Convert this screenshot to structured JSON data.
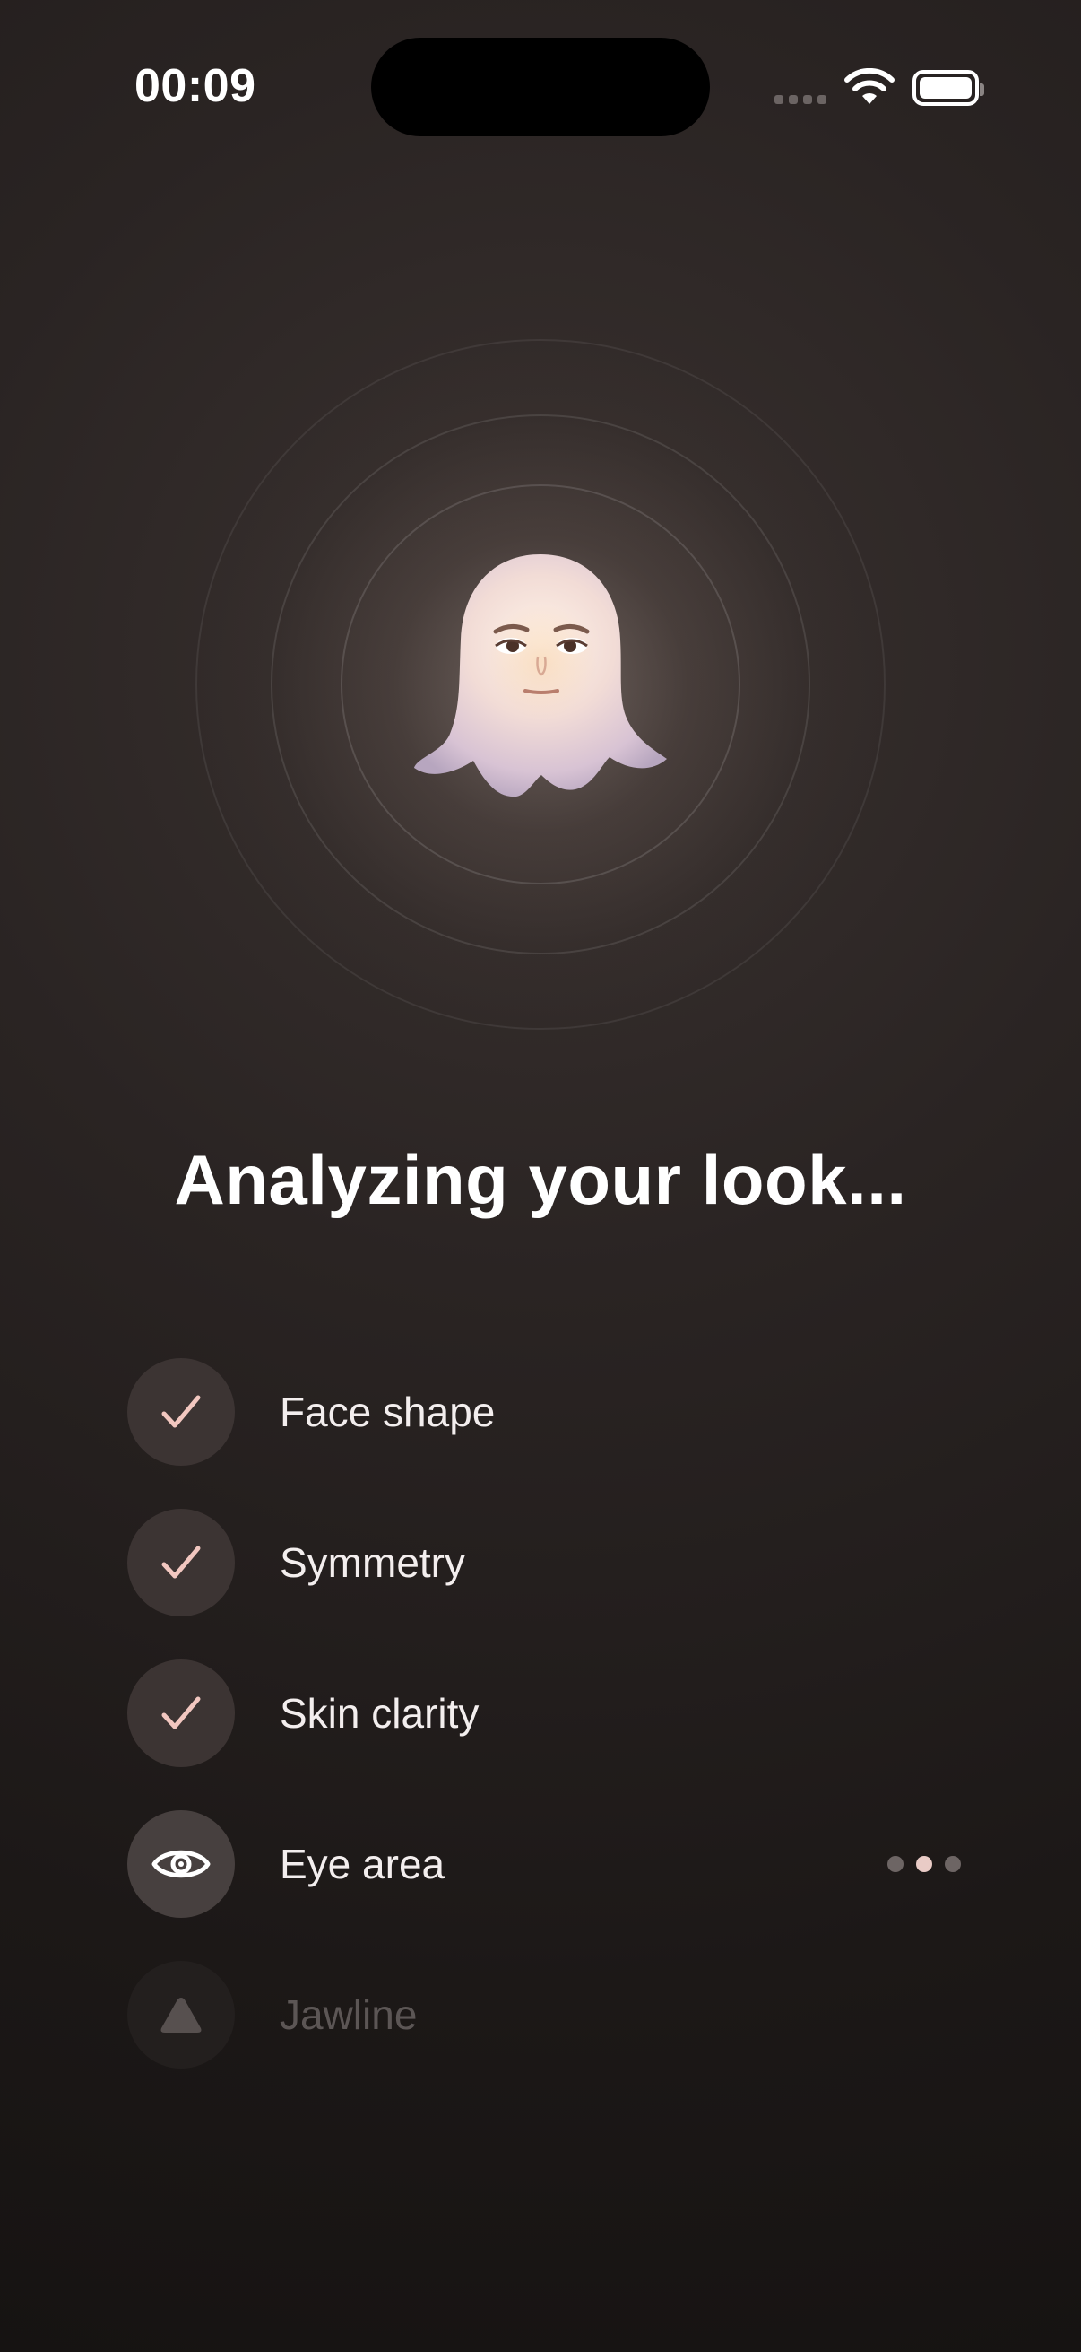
{
  "status_bar": {
    "time": "00:09"
  },
  "title": "Analyzing your look...",
  "colors": {
    "background": "#1c1817",
    "check_accent": "#f2c7c0",
    "done_circle": "#3c3433",
    "active_circle": "#47403f",
    "pending_circle": "#231f1e",
    "pending_text": "#5c5655"
  },
  "checks": [
    {
      "label": "Face shape",
      "status": "done",
      "icon": "checkmark-icon"
    },
    {
      "label": "Symmetry",
      "status": "done",
      "icon": "checkmark-icon"
    },
    {
      "label": "Skin clarity",
      "status": "done",
      "icon": "checkmark-icon"
    },
    {
      "label": "Eye area",
      "status": "in-progress",
      "icon": "eye-icon"
    },
    {
      "label": "Jawline",
      "status": "pending",
      "icon": "triangle-icon"
    }
  ]
}
